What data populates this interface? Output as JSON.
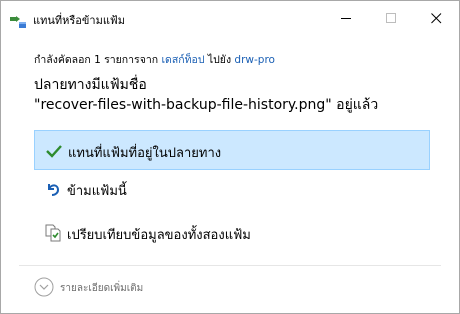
{
  "window": {
    "title": "แทนที่หรือข้ามแฟ้ม",
    "accent": "#1a5fb4",
    "selected_bg": "#cce8ff"
  },
  "transfer": {
    "prefix": "กำลังคัดลอก 1 รายการจาก ",
    "source": "เดสก์ท็อป",
    "middle": " ไปยัง ",
    "destination": "drw-pro"
  },
  "heading": {
    "line1": "ปลายทางมีแฟ้มชื่อ",
    "line2": "\"recover-files-with-backup-file-history.png\" อยู่แล้ว"
  },
  "options": [
    {
      "label": "แทนที่แฟ้มที่อยู่ในปลายทาง",
      "icon": "checkmark-icon",
      "selected": true
    },
    {
      "label": "ข้ามแฟ้มนี้",
      "icon": "skip-arrow-icon",
      "selected": false
    },
    {
      "label": "เปรียบเทียบข้อมูลของทั้งสองแฟ้ม",
      "icon": "compare-files-icon",
      "selected": false
    }
  ],
  "details": {
    "label": "รายละเอียดเพิ่มเติม",
    "icon": "chevron-down-circle-icon"
  }
}
